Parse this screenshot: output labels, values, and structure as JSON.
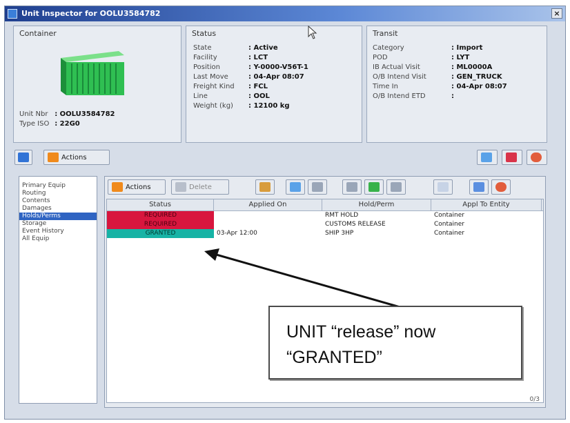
{
  "window": {
    "title": "Unit Inspector for OOLU3584782"
  },
  "container_panel": {
    "title": "Container",
    "fields": [
      {
        "key": "Unit Nbr",
        "value": ": OOLU3584782"
      },
      {
        "key": "Type ISO",
        "value": ": 22G0"
      }
    ]
  },
  "status_panel": {
    "title": "Status",
    "fields": [
      {
        "key": "State",
        "value": ": Active"
      },
      {
        "key": "Facility",
        "value": ": LCT"
      },
      {
        "key": "Position",
        "value": ": Y-0000-V56T-1"
      },
      {
        "key": "Last Move",
        "value": ": 04-Apr 08:07"
      },
      {
        "key": "Freight Kind",
        "value": ": FCL"
      },
      {
        "key": "Line",
        "value": ": OOL"
      },
      {
        "key": "Weight (kg)",
        "value": ": 12100 kg"
      }
    ]
  },
  "transit_panel": {
    "title": "Transit",
    "fields": [
      {
        "key": "Category",
        "value": ": Import"
      },
      {
        "key": "POD",
        "value": ": LYT"
      },
      {
        "key": "IB Actual Visit",
        "value": ": ML0000A"
      },
      {
        "key": "O/B Intend Visit",
        "value": ": GEN_TRUCK"
      },
      {
        "key": "Time In",
        "value": ": 04-Apr 08:07"
      },
      {
        "key": "O/B Intend ETD",
        "value": ":"
      }
    ]
  },
  "top_toolbar": {
    "actions_label": "Actions"
  },
  "sidebar": {
    "items": [
      {
        "label": "Primary Equip",
        "selected": false
      },
      {
        "label": "Routing",
        "selected": false
      },
      {
        "label": "Contents",
        "selected": false
      },
      {
        "label": "Damages",
        "selected": false
      },
      {
        "label": "Holds/Perms",
        "selected": true
      },
      {
        "label": "Storage",
        "selected": false
      },
      {
        "label": "Event History",
        "selected": false
      },
      {
        "label": "All Equip",
        "selected": false
      }
    ]
  },
  "grid_toolbar": {
    "actions_label": "Actions",
    "delete_label": "Delete"
  },
  "grid": {
    "columns": [
      "Status",
      "Applied On",
      "Hold/Perm",
      "Appl To Entity"
    ],
    "rows": [
      {
        "status": "REQUIRED",
        "applied_on": "",
        "hold": "RMT HOLD",
        "entity": "Container",
        "status_color": "red"
      },
      {
        "status": "REQUIRED",
        "applied_on": "",
        "hold": "CUSTOMS RELEASE",
        "entity": "Container",
        "status_color": "red"
      },
      {
        "status": "GRANTED",
        "applied_on": "03-Apr 12:00",
        "hold": "SHIP 3HP",
        "entity": "Container",
        "status_color": "green"
      }
    ]
  },
  "statusbar": {
    "text": "0/3"
  },
  "callout": {
    "line1": "UNIT “release” now",
    "line2": "“GRANTED”"
  },
  "colors": {
    "required": "#d8163e",
    "granted": "#17b3a5",
    "titlebar": "#1f3f8f"
  }
}
